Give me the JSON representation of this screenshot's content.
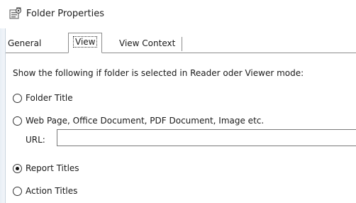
{
  "window": {
    "title": "Folder Properties",
    "icon": "folder-properties-icon"
  },
  "tabs": [
    {
      "label": "General",
      "selected": false
    },
    {
      "label": "View",
      "selected": true
    },
    {
      "label": "View Context",
      "selected": false
    }
  ],
  "view": {
    "intro": "Show the following if folder is selected in Reader oder Viewer mode:",
    "options": [
      {
        "label": "Folder Title",
        "checked": false
      },
      {
        "label": "Web Page, Office Document, PDF Document, Image etc.",
        "checked": false
      },
      {
        "label": "Report Titles",
        "checked": true
      },
      {
        "label": "Action Titles",
        "checked": false
      }
    ],
    "url_label": "URL:",
    "url_value": ""
  }
}
